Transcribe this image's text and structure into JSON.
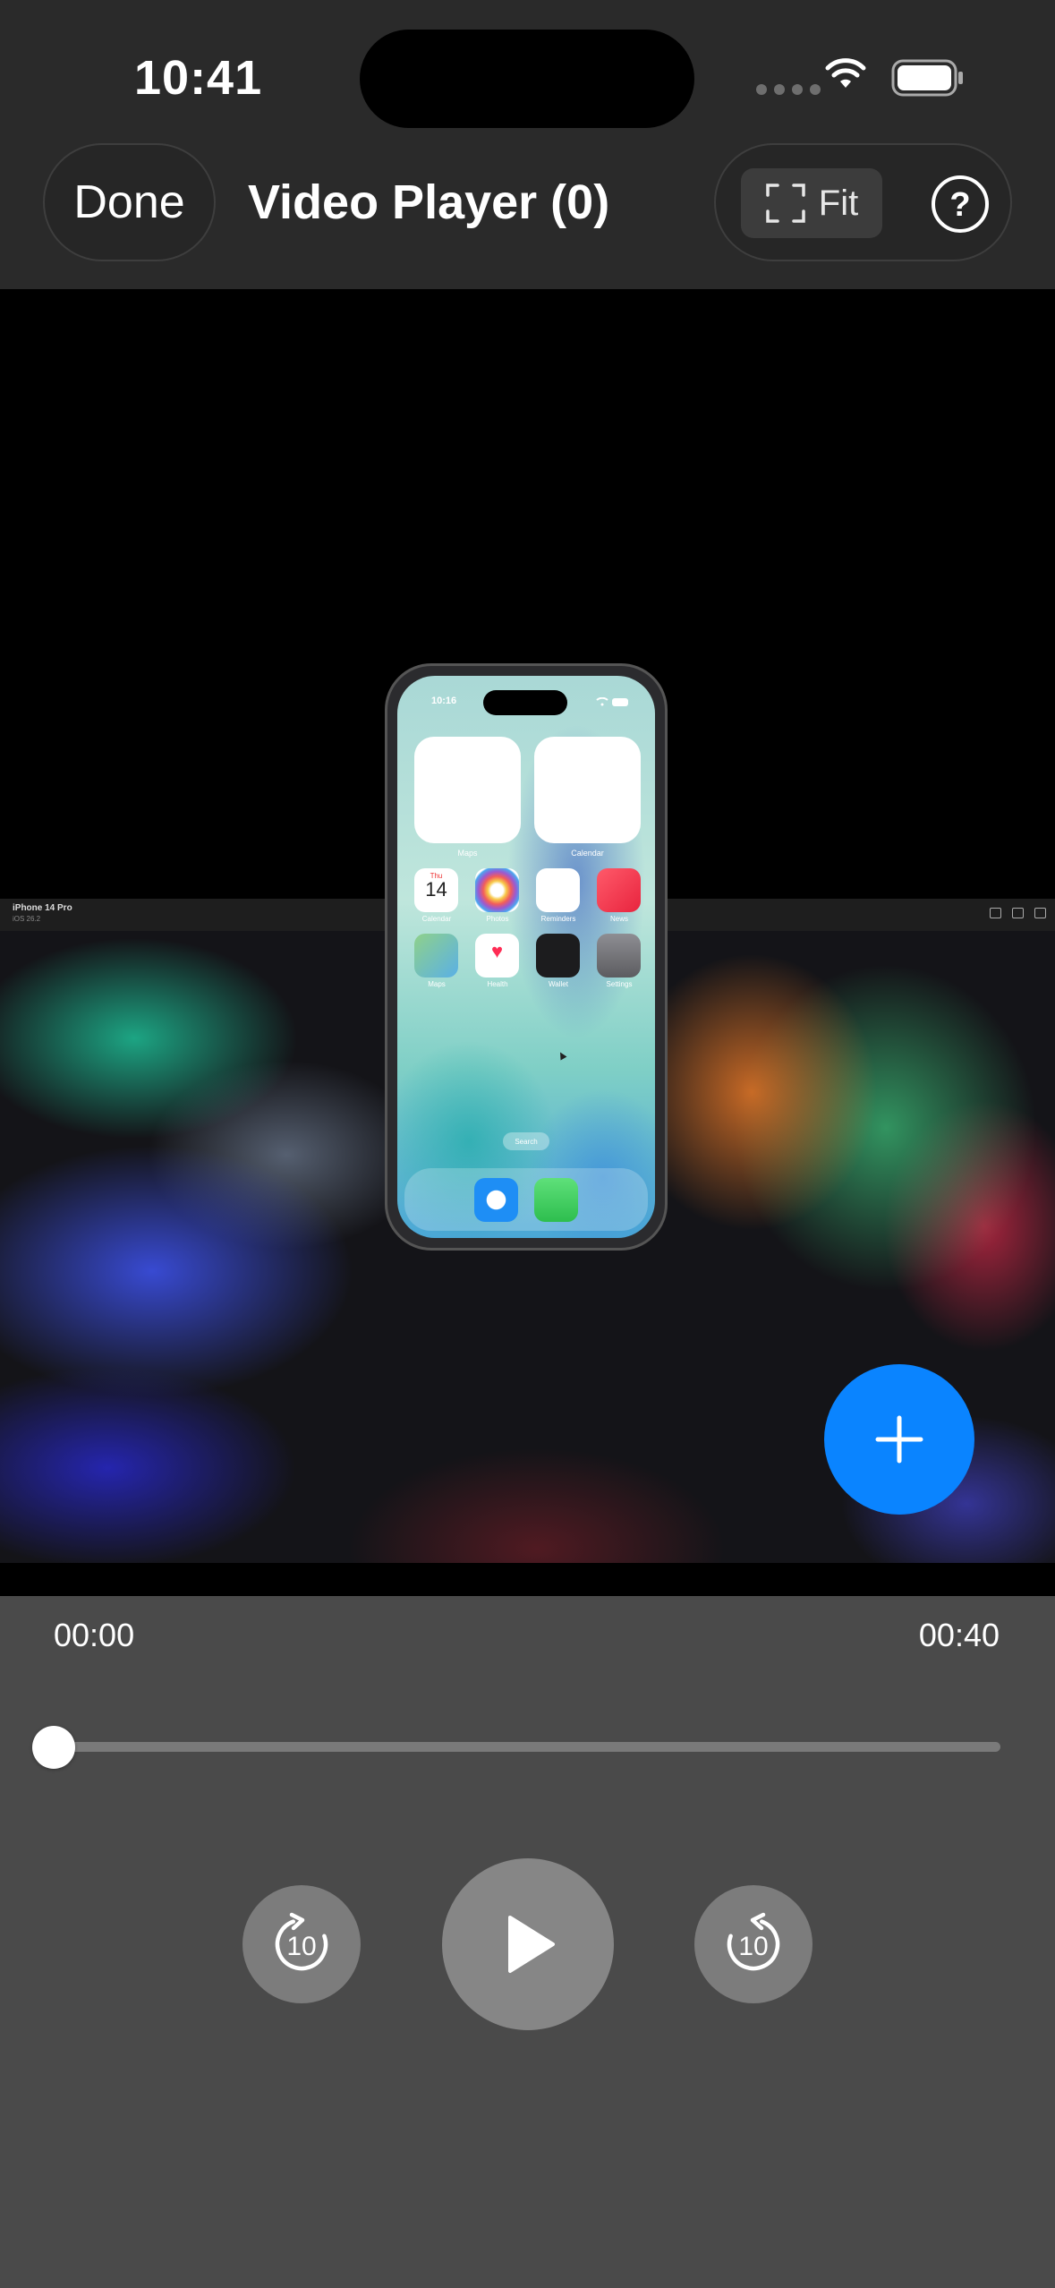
{
  "status_bar": {
    "time": "10:41"
  },
  "header": {
    "done_label": "Done",
    "title": "Video Player (0)",
    "fit_label": "Fit",
    "help_icon": "question-circle-icon"
  },
  "video": {
    "simulator": {
      "device_name": "iPhone 14 Pro",
      "os_version": "iOS 26.2"
    },
    "phone": {
      "time": "10:16",
      "widgets": [
        "Maps",
        "Calendar"
      ],
      "apps_row1": [
        "Calendar",
        "Photos",
        "Reminders",
        "News"
      ],
      "apps_row2": [
        "Maps",
        "Health",
        "Wallet",
        "Settings"
      ],
      "calendar_day": "Thu",
      "calendar_date": "14",
      "search_label": "Search",
      "dock": [
        "Safari",
        "Messages"
      ]
    }
  },
  "add_button_icon": "plus-icon",
  "player": {
    "current_time": "00:00",
    "total_time": "00:40",
    "progress": 0,
    "skip_back_seconds": "10",
    "skip_forward_seconds": "10"
  },
  "colors": {
    "accent": "#0a84ff",
    "header_bg": "#2a2a2a",
    "controls_bg": "#4a4a4a"
  }
}
